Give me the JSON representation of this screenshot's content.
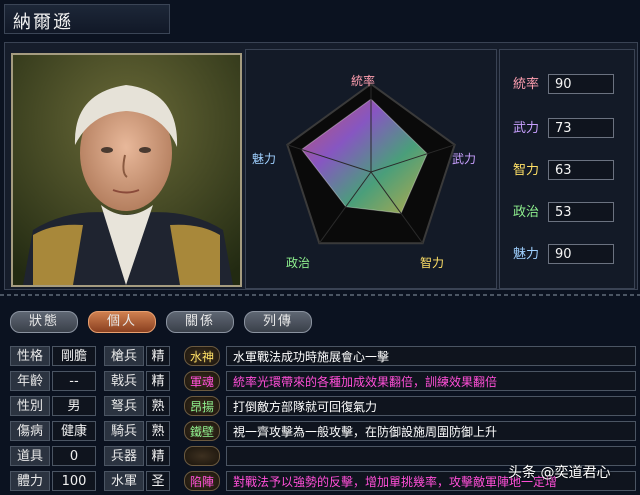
{
  "name": "納爾遜",
  "radar_labels": {
    "top": "統率",
    "right": "武力",
    "bottom_right": "智力",
    "bottom_left": "政治",
    "left": "魅力"
  },
  "stats": [
    {
      "label": "統率",
      "value": "90",
      "color": "#ff9fb0"
    },
    {
      "label": "武力",
      "value": "73",
      "color": "#c9a0ff"
    },
    {
      "label": "智力",
      "value": "63",
      "color": "#ffe066"
    },
    {
      "label": "政治",
      "value": "53",
      "color": "#8ef08e"
    },
    {
      "label": "魅力",
      "value": "90",
      "color": "#9fd0ff"
    }
  ],
  "stat_levels": [
    90,
    73,
    63,
    53,
    90
  ],
  "tabs": [
    "狀態",
    "個人",
    "關係",
    "列傳"
  ],
  "active_tab": "個人",
  "personal": [
    {
      "label": "性格",
      "value": "剛膽"
    },
    {
      "label": "年齡",
      "value": "--"
    },
    {
      "label": "性別",
      "value": "男"
    },
    {
      "label": "傷病",
      "value": "健康"
    },
    {
      "label": "道具",
      "value": "0"
    },
    {
      "label": "體力",
      "value": "100"
    }
  ],
  "troops": [
    {
      "label": "槍兵",
      "value": "精"
    },
    {
      "label": "戟兵",
      "value": "精"
    },
    {
      "label": "弩兵",
      "value": "熟"
    },
    {
      "label": "騎兵",
      "value": "熟"
    },
    {
      "label": "兵器",
      "value": "精"
    },
    {
      "label": "水軍",
      "value": "圣"
    }
  ],
  "skills": [
    {
      "name": "水神",
      "desc": "水軍戰法成功時施展會心一擊",
      "name_color": "#ffe066",
      "desc_color": "#ffffff"
    },
    {
      "name": "軍魂",
      "desc": "統率光環帶來的各種加成效果翻倍，訓練效果翻倍",
      "name_color": "#ff4fd8",
      "desc_color": "#ff4fd8"
    },
    {
      "name": "昂揚",
      "desc": "打倒敵方部隊就可回復氣力",
      "name_color": "#8ef08e",
      "desc_color": "#ffffff"
    },
    {
      "name": "鐵壁",
      "desc": "視一齊攻擊為一般攻擊，在防御設施周圍防御上升",
      "name_color": "#8ef08e",
      "desc_color": "#ffffff"
    },
    {
      "name": "",
      "desc": "",
      "name_color": "#ffffff",
      "desc_color": "#ffffff"
    },
    {
      "name": "陷陣",
      "desc": "對戰法予以強勢的反擊，增加單挑幾率，攻擊敵軍陣地一定增",
      "name_color": "#ff4fd8",
      "desc_color": "#ff4fd8"
    }
  ],
  "watermark": "头条 @奕道君心"
}
